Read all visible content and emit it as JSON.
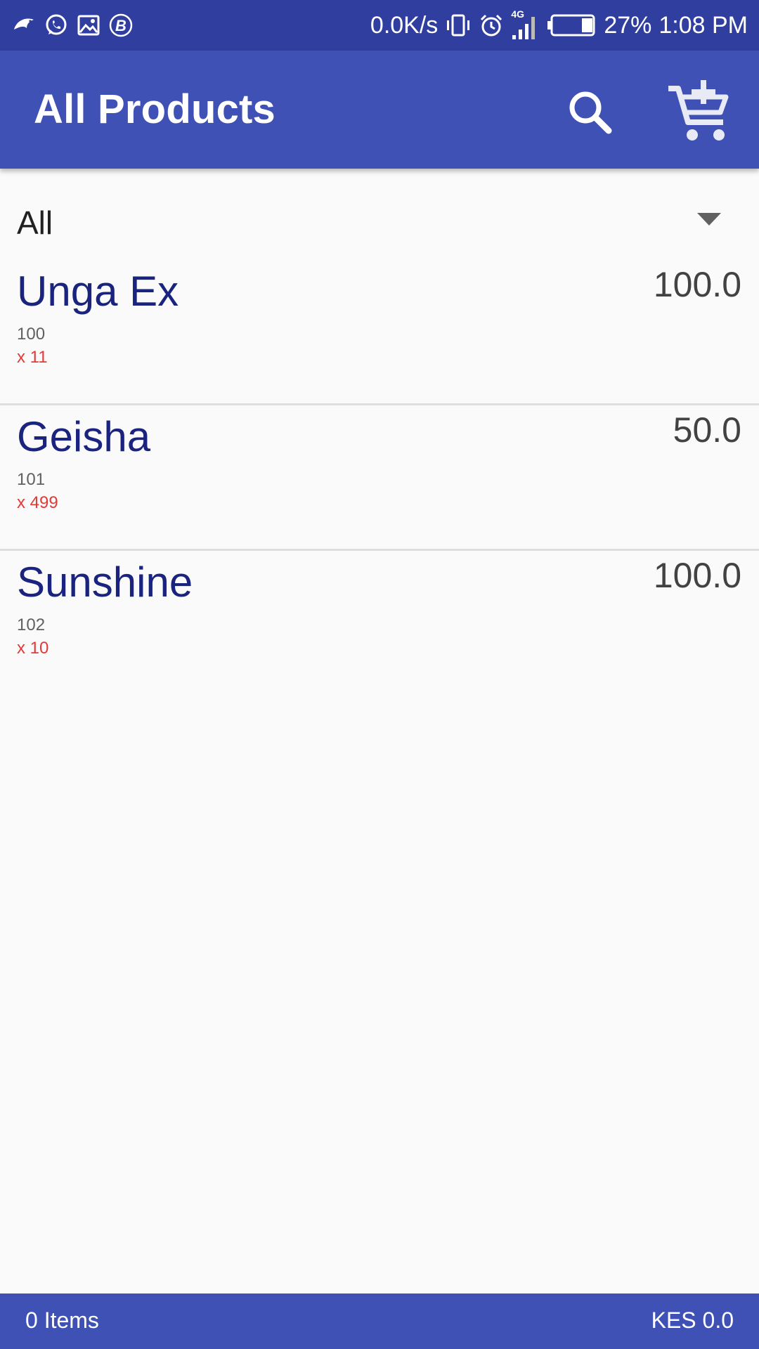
{
  "status_bar": {
    "net_speed": "0.0K/s",
    "signal_type": "4G",
    "battery_percent": "27%",
    "time": "1:08 PM",
    "battery_level": 0.27,
    "icons": [
      "bird-app-icon",
      "whatsapp-icon",
      "gallery-icon",
      "b-app-icon",
      "vibrate-icon",
      "alarm-icon",
      "signal-icon",
      "battery-icon"
    ]
  },
  "app_bar": {
    "title": "All Products",
    "color": "#3f51b5",
    "actions": [
      "search-icon",
      "add-to-cart-icon"
    ]
  },
  "filter": {
    "selected": "All"
  },
  "products": [
    {
      "name": "Unga Ex",
      "code": "100",
      "quantity": "x 11",
      "price": "100.0"
    },
    {
      "name": "Geisha",
      "code": "101",
      "quantity": "x 499",
      "price": "50.0"
    },
    {
      "name": "Sunshine",
      "code": "102",
      "quantity": "x 10",
      "price": "100.0"
    }
  ],
  "bottom_bar": {
    "items_count": "0 Items",
    "total": "KES 0.0"
  }
}
